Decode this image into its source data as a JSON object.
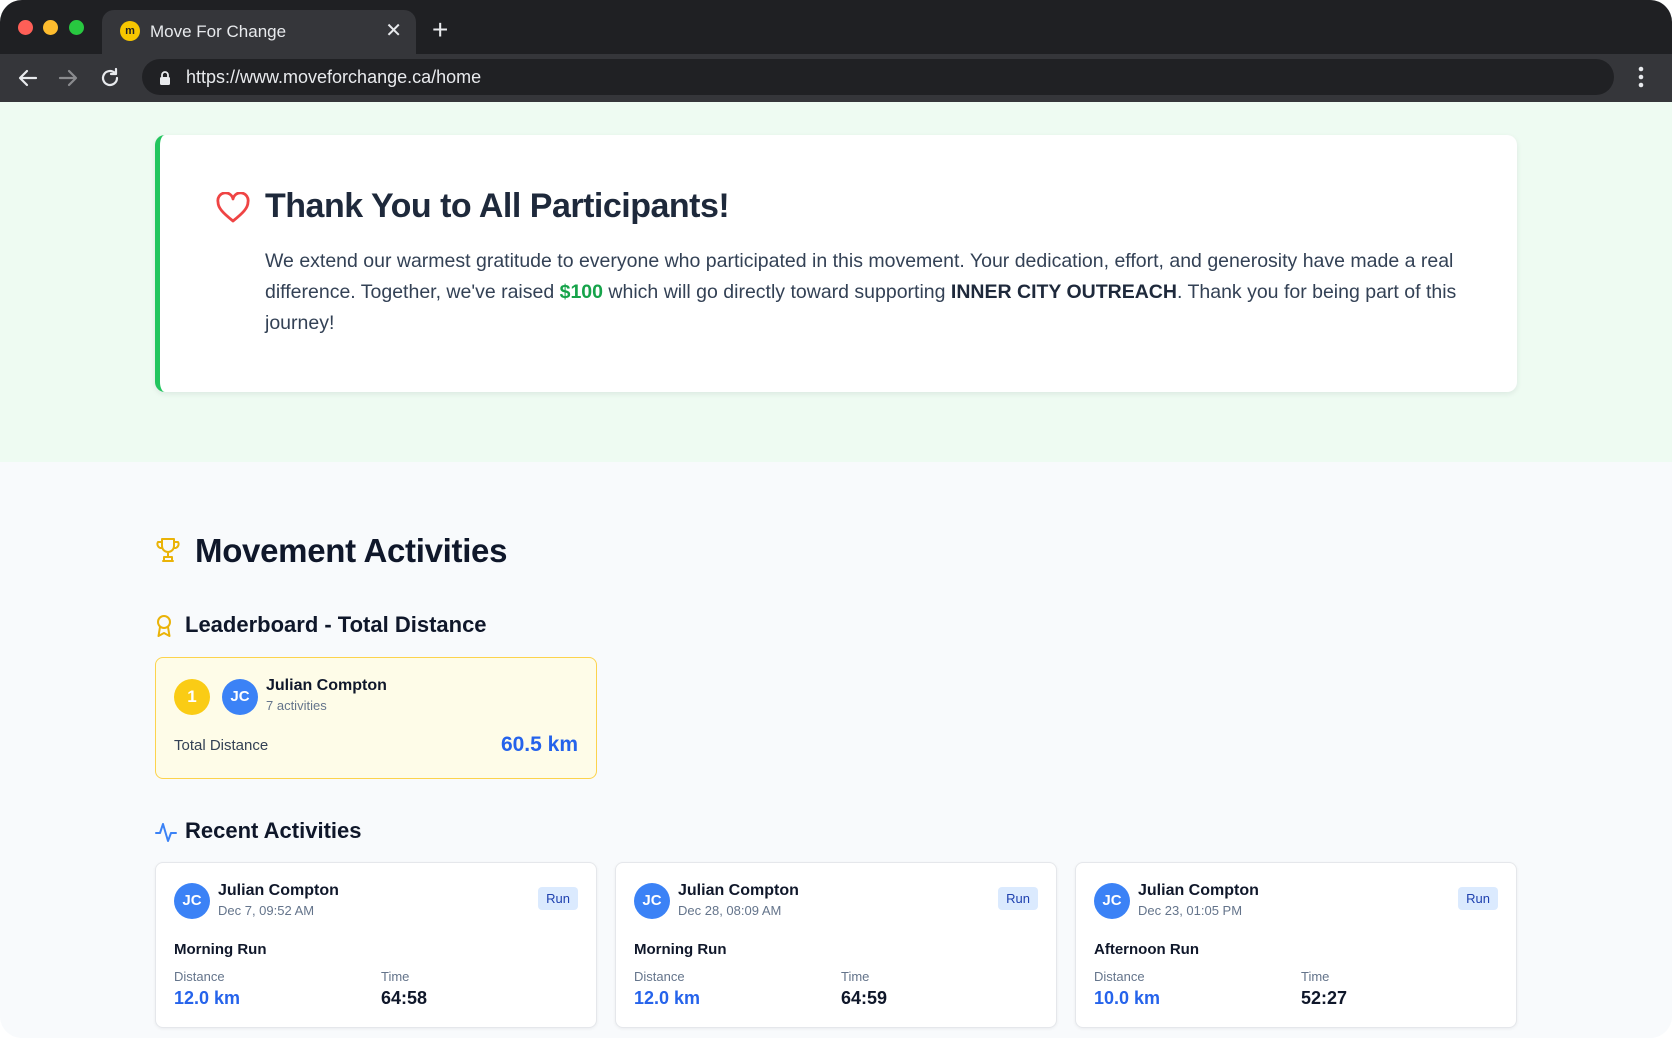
{
  "browser": {
    "tab_title": "Move For Change",
    "favicon_letter": "m",
    "tab_close": "✕",
    "new_tab": "+",
    "url": "https://www.moveforchange.ca/home"
  },
  "thanks": {
    "title": "Thank You to All Participants!",
    "body_part1": "We extend our warmest gratitude to everyone who participated in this movement. Your dedication, effort, and generosity have made a real difference. Together, we've raised ",
    "amount": "$100",
    "body_part2": " which will go directly toward supporting ",
    "organization": "INNER CITY OUTREACH",
    "body_part3": ". Thank you for being part of this journey!"
  },
  "activities": {
    "title": "Movement Activities",
    "leaderboard_title": "Leaderboard - Total Distance",
    "leaderboard": [
      {
        "rank": "1",
        "initials": "JC",
        "name": "Julian Compton",
        "activities": "7 activities",
        "total_label": "Total Distance",
        "total_value": "60.5 km"
      }
    ],
    "recent_title": "Recent Activities",
    "recent": [
      {
        "initials": "JC",
        "name": "Julian Compton",
        "date": "Dec 7, 09:52 AM",
        "type": "Run",
        "title": "Morning Run",
        "distance_label": "Distance",
        "distance": "12.0 km",
        "time_label": "Time",
        "time": "64:58"
      },
      {
        "initials": "JC",
        "name": "Julian Compton",
        "date": "Dec 28, 08:09 AM",
        "type": "Run",
        "title": "Morning Run",
        "distance_label": "Distance",
        "distance": "12.0 km",
        "time_label": "Time",
        "time": "64:59"
      },
      {
        "initials": "JC",
        "name": "Julian Compton",
        "date": "Dec 23, 01:05 PM",
        "type": "Run",
        "title": "Afternoon Run",
        "distance_label": "Distance",
        "distance": "10.0 km",
        "time_label": "Time",
        "time": "52:27"
      }
    ]
  },
  "colors": {
    "accent_green": "#22c55e",
    "accent_blue": "#2563eb",
    "gold": "#facc15"
  }
}
